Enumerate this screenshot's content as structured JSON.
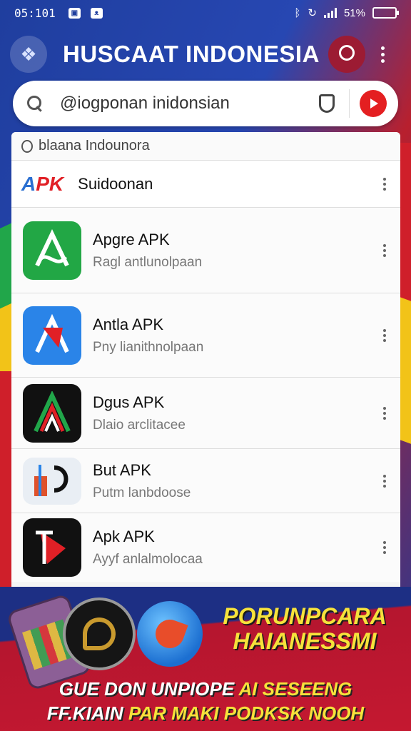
{
  "status_bar": {
    "time": "05:101",
    "battery_text": "51%",
    "battery_level": 0.51,
    "left_icons": [
      "image-icon",
      "cat-icon"
    ],
    "right_icons": [
      "bluetooth-icon",
      "sync-icon",
      "signal-icon"
    ]
  },
  "app_bar": {
    "title": "HUSCAAT INDONESIA",
    "logo_icon": "app-logo-icon",
    "profile_icon": "profile-icon",
    "menu_icon": "more-vert-icon"
  },
  "search": {
    "value": "@iogponan inidonsian",
    "icons": [
      "search-icon",
      "shield-icon",
      "play-icon"
    ],
    "play_color": "#e41f21"
  },
  "list": {
    "filter_text": "blaana Indounora",
    "header": {
      "logo": {
        "a": "A",
        "p": "P",
        "k": "PK"
      },
      "label": "Suidoonan"
    },
    "items": [
      {
        "name": "Apgre APK",
        "sub": "Ragl antlunolpaan",
        "icon": "apgre-app-icon",
        "color": "#22a745"
      },
      {
        "name": "Antla APK",
        "sub": "Pny lianithnolpaan",
        "icon": "antla-app-icon",
        "color": "#2a84e8"
      },
      {
        "name": "Dgus APK",
        "sub": "Dlaio arclitacee",
        "icon": "dgus-app-icon",
        "color": "#111111"
      },
      {
        "name": "But APK",
        "sub": "Putm lanbdoose",
        "icon": "but-app-icon",
        "color": "#e9eef4"
      },
      {
        "name": "Apk APK",
        "sub": "Ayyf anlalmolocaa",
        "icon": "apk-app-icon",
        "color": "#111111"
      }
    ]
  },
  "banner": {
    "title_line1": "PORUNPCARA",
    "title_line2": "HAIANESSMI",
    "line1_a": "GUE DON UNPIOPE ",
    "line1_b": "AI SESEENG",
    "line2_a": "FF.KIAIN ",
    "line2_b": "PAR MAKI PODKSK NOOH"
  }
}
